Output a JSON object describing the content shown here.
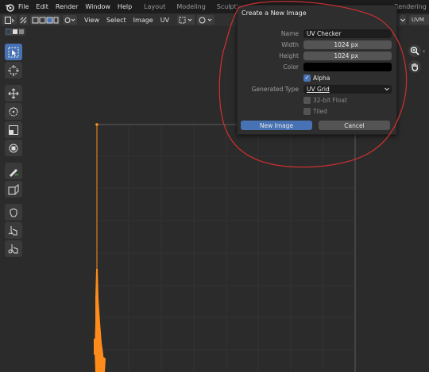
{
  "topbar": {
    "menus": [
      "File",
      "Edit",
      "Render",
      "Window",
      "Help"
    ],
    "workspaces": [
      "Layout",
      "Modeling",
      "Sculpting"
    ],
    "workspace_right": "Rendering"
  },
  "header": {
    "menus": [
      "View",
      "Select",
      "Image",
      "UV"
    ],
    "image_field": "UVM"
  },
  "dialog": {
    "title": "Create a New Image",
    "name_label": "Name",
    "name_value": "UV Checker",
    "width_label": "Width",
    "width_value": "1024 px",
    "height_label": "Height",
    "height_value": "1024 px",
    "color_label": "Color",
    "color_value": "#000000",
    "alpha_label": "Alpha",
    "alpha_checked": true,
    "generated_type_label": "Generated Type",
    "generated_type_value": "UV Grid",
    "float_label": "32-bit Float",
    "float_checked": false,
    "tiled_label": "Tiled",
    "tiled_checked": false,
    "ok_label": "New Image",
    "cancel_label": "Cancel"
  },
  "colors": {
    "accent": "#4772b3",
    "annotation": "#d03030",
    "uv_edge": "#ff8c1a"
  },
  "tools": [
    "select-tool",
    "cursor-tool",
    "move-tool",
    "rotate-tool",
    "scale-tool",
    "transform-tool",
    "annotate-tool",
    "rip-tool",
    "grab-tool",
    "relax-tool",
    "pinch-tool"
  ]
}
